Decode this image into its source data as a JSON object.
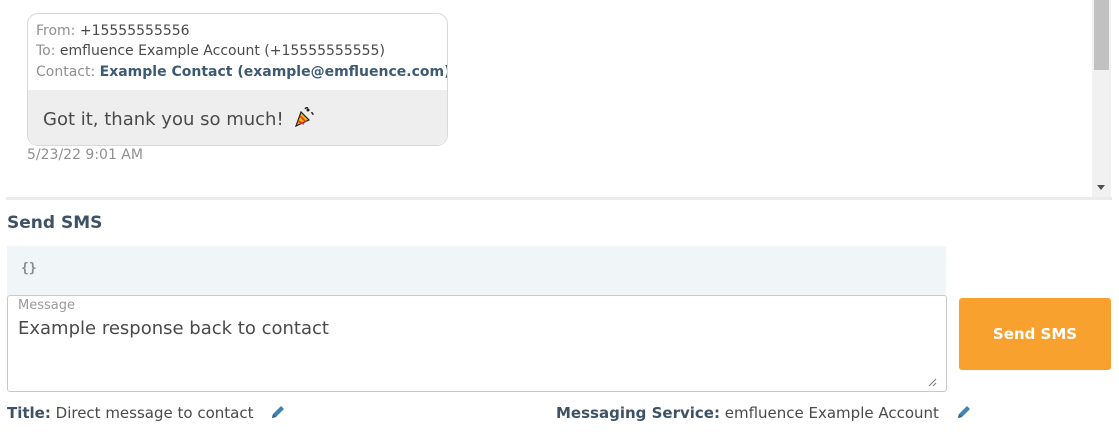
{
  "thread": {
    "message": {
      "from_label": "From:",
      "from_value": "+15555555556",
      "to_label": "To:",
      "to_value": "emfluence Example Account (+15555555555)",
      "contact_label": "Contact:",
      "contact_value": "Example Contact (example@emfluence.com)",
      "contact_icon": "chat-bubble-icon",
      "body": "Got it, thank you so much!",
      "emoji": "party-popper-icon",
      "timestamp": "5/23/22 9:01 AM"
    }
  },
  "composer": {
    "section_title": "Send SMS",
    "merge_tag": "{}",
    "message_label": "Message",
    "message_value": "Example response back to contact",
    "send_label": "Send SMS",
    "accent_color": "#f8a12e"
  },
  "footer": {
    "title_label": "Title:",
    "title_value": "Direct message to contact",
    "service_label": "Messaging Service:",
    "service_value": "emfluence Example Account",
    "edit_icon": "pencil-icon"
  }
}
